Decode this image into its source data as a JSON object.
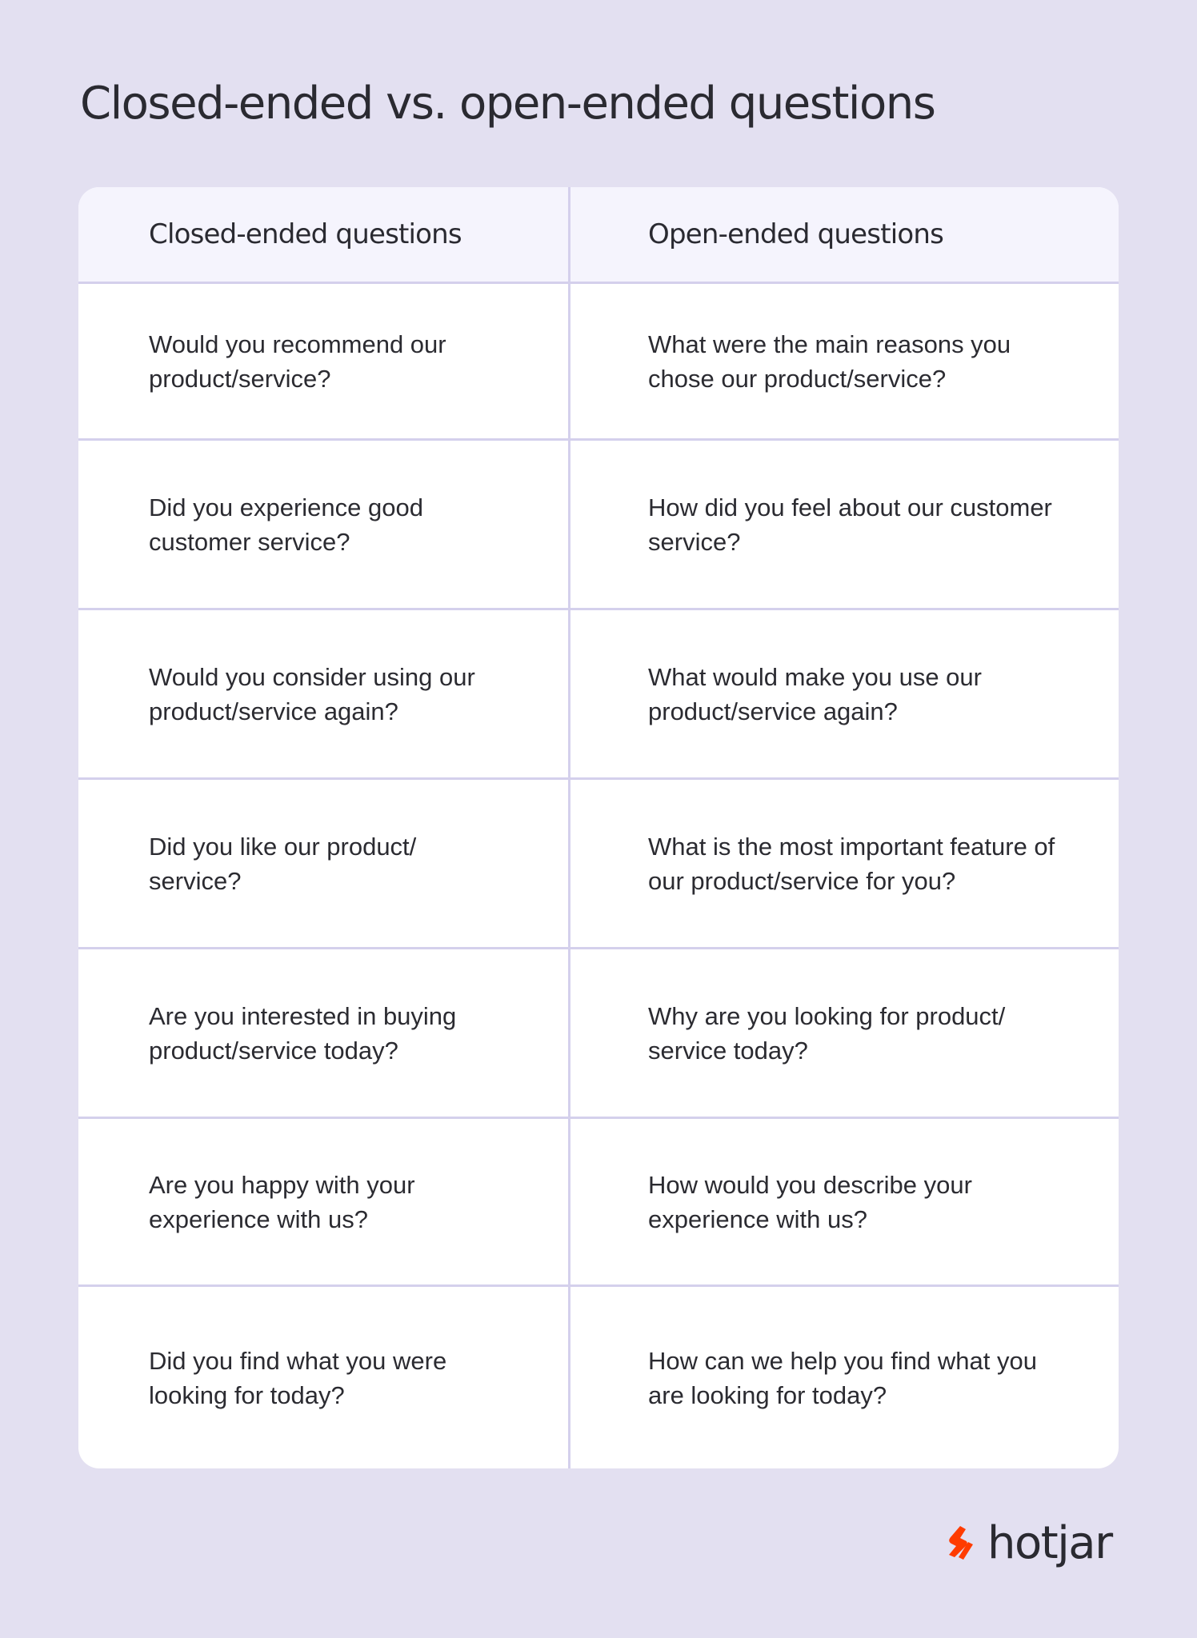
{
  "page": {
    "title": "Closed-ended vs. open-ended questions"
  },
  "table": {
    "headers": [
      "Closed-ended questions",
      "Open-ended questions"
    ],
    "rows": [
      [
        "Would you recommend our product/service?",
        "What were the main reasons you chose our product/service?"
      ],
      [
        "Did you experience good customer service?",
        "How did you feel about our customer service?"
      ],
      [
        "Would you consider using our product/service again?",
        "What would make you use our product/service again?"
      ],
      [
        "Did you like our product/ service?",
        "What is the most important feature of our product/service for you?"
      ],
      [
        "Are you interested in buying product/service today?",
        "Why are you looking for product/ service today?"
      ],
      [
        "Are you happy with your experience with us?",
        "How would you describe your experience with us?"
      ],
      [
        "Did you find what you were looking for today?",
        "How can we help you find what you are looking for today?"
      ]
    ]
  },
  "logo": {
    "text": "hotjar",
    "icon": "hotjar-flame-icon",
    "color": "#ff3c00"
  },
  "colors": {
    "background": "#e3e0f1",
    "header_row": "#f5f4fd",
    "grid_line": "#d4d0ec",
    "text": "#2a2a31"
  }
}
